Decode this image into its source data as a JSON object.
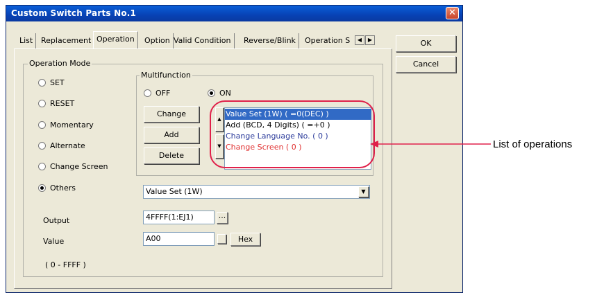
{
  "window": {
    "title": "Custom Switch Parts No.1",
    "close_glyph": "✕"
  },
  "tabs": [
    {
      "label": "List"
    },
    {
      "label": "Replacement"
    },
    {
      "label": "Operation"
    },
    {
      "label": "Option"
    },
    {
      "label": "Valid Condition"
    },
    {
      "label": "Reverse/Blink"
    },
    {
      "label": "Operation S"
    }
  ],
  "tab_scroll": {
    "left": "◀",
    "right": "▶"
  },
  "buttons": {
    "ok": "OK",
    "cancel": "Cancel"
  },
  "operation_mode": {
    "label": "Operation Mode",
    "options": [
      "SET",
      "RESET",
      "Momentary",
      "Alternate",
      "Change Screen",
      "Others"
    ],
    "selected": "Others"
  },
  "multifunction": {
    "label": "Multifunction",
    "off_label": "OFF",
    "on_label": "ON",
    "selected": "ON",
    "change_label": "Change",
    "add_label": "Add",
    "delete_label": "Delete",
    "operations": [
      {
        "text": "Value Set (1W) ( =0(DEC) )",
        "color": "#ffffff",
        "selected": true
      },
      {
        "text": "Add (BCD, 4 Digits) ( =+0 )",
        "color": "#000000",
        "selected": false
      },
      {
        "text": "Change Language No. ( 0 )",
        "color": "#2a3a9a",
        "selected": false
      },
      {
        "text": "Change Screen ( 0 )",
        "color": "#e03030",
        "selected": false
      }
    ]
  },
  "others_select": {
    "value": "Value Set (1W)"
  },
  "output": {
    "label": "Output",
    "value": "4FFFF(1:EJ1)",
    "browse": "..."
  },
  "value": {
    "label": "Value",
    "value": "A00",
    "hex_label": "Hex",
    "range": "( 0 - FFFF )"
  },
  "annotation": {
    "text": "List of operations",
    "color": "#e0204a"
  }
}
